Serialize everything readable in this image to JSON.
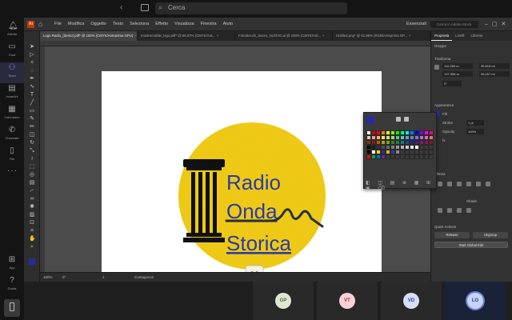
{
  "teams": {
    "search_placeholder": "Cerca",
    "rail": [
      {
        "label": "Attività",
        "icon": "bell-icon"
      },
      {
        "label": "Chat",
        "icon": "chat-icon"
      },
      {
        "label": "Team",
        "icon": "team-icon"
      },
      {
        "label": "Incarichi",
        "icon": "assignments-icon"
      },
      {
        "label": "Calendario",
        "icon": "calendar-icon"
      },
      {
        "label": "Chiamate",
        "icon": "phone-icon"
      },
      {
        "label": "File",
        "icon": "file-icon"
      }
    ],
    "rail_bottom": [
      {
        "label": "App",
        "icon": "apps-icon"
      },
      {
        "label": "Guida",
        "icon": "help-icon"
      }
    ],
    "participants": [
      {
        "initials": "GP",
        "bg": "#dfe7d2",
        "fg": "#4a6a2c"
      },
      {
        "initials": "VT",
        "bg": "#f7d2d8",
        "fg": "#b0263f"
      },
      {
        "initials": "VD",
        "bg": "#d8def7",
        "fg": "#2c3f9a"
      },
      {
        "initials": "LG",
        "bg": "#c7d3f3",
        "fg": "#2a3c8d"
      }
    ]
  },
  "illustrator": {
    "app_badge": "Ai",
    "menu": [
      "File",
      "Modifica",
      "Oggetto",
      "Testo",
      "Seleziona",
      "Effetto",
      "Visualizza",
      "Finestra",
      "Aiuto"
    ],
    "workspace": "Essenziali",
    "workspace_search": "Cerca in Adobe Stock",
    "tabs": [
      {
        "label": "Logo Radio_(demo).pdf* @ 100% (CMYK/Anteprima GPU)",
        "active": true
      },
      {
        "label": "mostremobile_logo.pdf* @ 66,67% (CMYK/Ant...",
        "active": false
      },
      {
        "label": "Fotoritocchi_lavoro_NUOVO.ai @ 100% (CMYK/Ant...",
        "active": false
      },
      {
        "label": "Untitled.png* @ 61,86% (RGB/Anteprima GP...",
        "active": false
      }
    ],
    "status": {
      "zoom": "100%",
      "angle": "0°",
      "artboard": "1",
      "tool": "Contagocce"
    },
    "props_tabs": [
      "Proprietà",
      "Livelli",
      "Librerie"
    ],
    "props": {
      "group_label": "Gruppo",
      "transform_label": "Trasforma",
      "x": "110,289 m",
      "y": "137,996 m",
      "w": "96,815 mi",
      "h": "96,267 mi",
      "angle": "0°",
      "appearance_label": "Appearance",
      "fill_label": "Fill",
      "fill_color": "#2b2a9c",
      "stroke_label": "Stroke",
      "stroke_value": "1 pt",
      "opacity_label": "Opacity",
      "opacity_value": "100%",
      "fx_label": "fx",
      "align_label": "Allinea",
      "quick_actions_label": "Quick Actions",
      "release_btn": "Release",
      "ungroup_btn": "Ungroup",
      "start_global_btn": "Start Global Edit",
      "shade_label": "Shade"
    },
    "logo": {
      "bg_color": "#f4cf1a",
      "text_color": "#2b3aa8",
      "line1": "Radio",
      "line2": "Onda",
      "line3": "Storica",
      "badge": "M"
    },
    "swatches": [
      "#ffffff",
      "#d0021b",
      "#ff0000",
      "#ff7f00",
      "#ffff00",
      "#7fff00",
      "#00ff00",
      "#00ff7f",
      "#00ffff",
      "#007fff",
      "#0000ff",
      "#7f00ff",
      "#ff00ff",
      "#ff007f",
      "#f2c8a0",
      "#e89a9a",
      "#f4b26a",
      "#f7e26b",
      "#cce26b",
      "#9bd87a",
      "#5fc37a",
      "#5fbfb6",
      "#5f9fd8",
      "#6c7fd6",
      "#8a6fd0",
      "#b06fc8",
      "#d86fa8",
      "#e06f7f",
      "#7a3a1a",
      "#8a1a1a",
      "#b25a1a",
      "#b2a01a",
      "#7aa01a",
      "#3a801a",
      "#1a804a",
      "#1a7a80",
      "#1a4a80",
      "#1a2a80",
      "#4a1a80",
      "#7a1a80",
      "#801a5a",
      "#801a2a",
      "#000000",
      "#1a1a1a",
      "#333333",
      "#4d4d4d",
      "#666666",
      "#808080",
      "#999999",
      "#b3b3b3",
      "#cccccc",
      "#e6e6e6",
      "#ffffff",
      "#3a3a3a",
      "#3a3a3a",
      "#3a3a3a",
      "#000000",
      "#ffffff",
      "#f4cf1a",
      "#2b2a9c",
      "#e6b800",
      "#2b3aa8",
      "#888888",
      "#3a3a3a",
      "#3a3a3a",
      "#3a3a3a",
      "#3a3a3a",
      "#3a3a3a",
      "#3a3a3a",
      "#3a3a3a",
      "#ff0000",
      "#00a651",
      "#0072bc",
      "#662d91",
      "#3a3a3a",
      "#3a3a3a",
      "#3a3a3a",
      "#3a3a3a",
      "#3a3a3a",
      "#3a3a3a",
      "#3a3a3a",
      "#3a3a3a",
      "#3a3a3a",
      "#3a3a3a"
    ]
  }
}
